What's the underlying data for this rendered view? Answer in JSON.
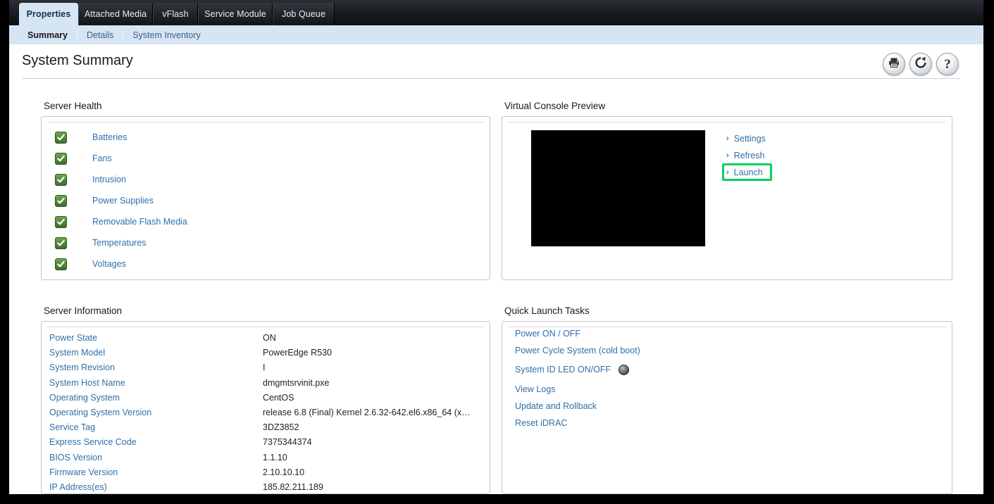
{
  "tabs": [
    {
      "label": "Properties",
      "active": true
    },
    {
      "label": "Attached Media",
      "active": false
    },
    {
      "label": "vFlash",
      "active": false
    },
    {
      "label": "Service Module",
      "active": false
    },
    {
      "label": "Job Queue",
      "active": false
    }
  ],
  "subtabs": [
    {
      "label": "Summary",
      "active": true
    },
    {
      "label": "Details",
      "active": false
    },
    {
      "label": "System Inventory",
      "active": false
    }
  ],
  "page": {
    "title": "System Summary"
  },
  "title_actions": [
    {
      "name": "print-icon",
      "label": "Print"
    },
    {
      "name": "refresh-icon",
      "label": "Refresh"
    },
    {
      "name": "help-icon",
      "label": "Help"
    }
  ],
  "server_health": {
    "title": "Server Health",
    "status_icon": "green-check-icon",
    "items": [
      {
        "label": "Batteries",
        "status": "ok"
      },
      {
        "label": "Fans",
        "status": "ok"
      },
      {
        "label": "Intrusion",
        "status": "ok"
      },
      {
        "label": "Power Supplies",
        "status": "ok"
      },
      {
        "label": "Removable Flash Media",
        "status": "ok"
      },
      {
        "label": "Temperatures",
        "status": "ok"
      },
      {
        "label": "Voltages",
        "status": "ok"
      }
    ]
  },
  "virtual_console": {
    "title": "Virtual Console Preview",
    "preview_state": "black",
    "links": [
      {
        "label": "Settings",
        "highlighted": false
      },
      {
        "label": "Refresh",
        "highlighted": false
      },
      {
        "label": "Launch",
        "highlighted": true
      }
    ],
    "highlight_color": "#00d45e"
  },
  "server_information": {
    "title": "Server Information",
    "rows": [
      {
        "label": "Power State",
        "value": "ON"
      },
      {
        "label": "System Model",
        "value": "PowerEdge R530"
      },
      {
        "label": "System Revision",
        "value": "I"
      },
      {
        "label": "System Host Name",
        "value": "dmgmtsrvinit.pxe"
      },
      {
        "label": "Operating System",
        "value": "CentOS"
      },
      {
        "label": "Operating System Version",
        "value": "release 6.8 (Final) Kernel 2.6.32-642.el6.x86_64 (x8…"
      },
      {
        "label": "Service Tag",
        "value": "3DZ3852"
      },
      {
        "label": "Express Service Code",
        "value": "7375344374"
      },
      {
        "label": "BIOS Version",
        "value": "1.1.10"
      },
      {
        "label": "Firmware Version",
        "value": "2.10.10.10"
      },
      {
        "label": "IP Address(es)",
        "value": "185.82.211.189"
      }
    ]
  },
  "quick_launch": {
    "title": "Quick Launch Tasks",
    "tasks": [
      {
        "label": "Power ON / OFF",
        "has_led": false
      },
      {
        "label": "Power Cycle System (cold boot)",
        "has_led": false
      },
      {
        "label": "System ID LED ON/OFF",
        "has_led": true
      },
      {
        "label": "View Logs",
        "has_led": false
      },
      {
        "label": "Update and Rollback",
        "has_led": false
      },
      {
        "label": "Reset iDRAC",
        "has_led": false
      }
    ]
  },
  "colors": {
    "link": "#2f6fa8",
    "tab_active_bg": "#d6e5f4",
    "health_ok": "#54893a",
    "highlight": "#00d45e"
  }
}
